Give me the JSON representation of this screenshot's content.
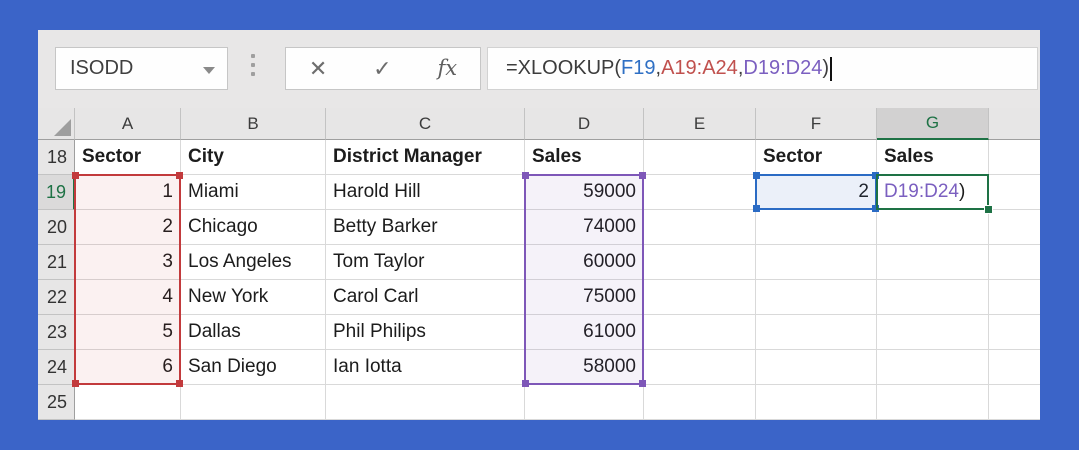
{
  "name_box": {
    "value": "ISODD"
  },
  "formula_buttons": {
    "cancel": "✕",
    "enter": "✓",
    "insert_function": "fx"
  },
  "formula_bar": {
    "tokens": [
      {
        "text": "=XLOOKUP(",
        "color": "#3c3c3c"
      },
      {
        "text": "F19",
        "color": "#2e6fc4"
      },
      {
        "text": ",",
        "color": "#3c3c3c"
      },
      {
        "text": "A19:A24",
        "color": "#c0504d"
      },
      {
        "text": ",",
        "color": "#3c3c3c"
      },
      {
        "text": "D19:D24",
        "color": "#7b5fc0"
      },
      {
        "text": ")",
        "color": "#3c3c3c"
      }
    ]
  },
  "sheet": {
    "columns": [
      "A",
      "B",
      "C",
      "D",
      "E",
      "F",
      "G"
    ],
    "active_column": "G",
    "active_row": "19",
    "rows": [
      {
        "num": "18",
        "cells": [
          {
            "col": "A",
            "text": "Sector",
            "bold": true
          },
          {
            "col": "B",
            "text": "City",
            "bold": true
          },
          {
            "col": "C",
            "text": "District Manager",
            "bold": true
          },
          {
            "col": "D",
            "text": "Sales",
            "bold": true
          },
          {
            "col": "F",
            "text": "Sector",
            "bold": true
          },
          {
            "col": "G",
            "text": "Sales",
            "bold": true
          }
        ]
      },
      {
        "num": "19",
        "cells": [
          {
            "col": "A",
            "text": "1",
            "align": "right"
          },
          {
            "col": "B",
            "text": "Miami"
          },
          {
            "col": "C",
            "text": "Harold Hill"
          },
          {
            "col": "D",
            "text": "59000",
            "align": "right"
          },
          {
            "col": "F",
            "text": "2",
            "align": "right"
          },
          {
            "col": "G",
            "tokens": [
              {
                "text": "D19:D24",
                "color": "#7b5fc0"
              },
              {
                "text": ")",
                "color": "#1c1c1c"
              }
            ]
          }
        ]
      },
      {
        "num": "20",
        "cells": [
          {
            "col": "A",
            "text": "2",
            "align": "right"
          },
          {
            "col": "B",
            "text": "Chicago"
          },
          {
            "col": "C",
            "text": "Betty Barker"
          },
          {
            "col": "D",
            "text": "74000",
            "align": "right"
          }
        ]
      },
      {
        "num": "21",
        "cells": [
          {
            "col": "A",
            "text": "3",
            "align": "right"
          },
          {
            "col": "B",
            "text": "Los Angeles"
          },
          {
            "col": "C",
            "text": "Tom Taylor"
          },
          {
            "col": "D",
            "text": "60000",
            "align": "right"
          }
        ]
      },
      {
        "num": "22",
        "cells": [
          {
            "col": "A",
            "text": "4",
            "align": "right"
          },
          {
            "col": "B",
            "text": "New York"
          },
          {
            "col": "C",
            "text": "Carol Carl"
          },
          {
            "col": "D",
            "text": "75000",
            "align": "right"
          }
        ]
      },
      {
        "num": "23",
        "cells": [
          {
            "col": "A",
            "text": "5",
            "align": "right"
          },
          {
            "col": "B",
            "text": "Dallas"
          },
          {
            "col": "C",
            "text": "Phil Philips"
          },
          {
            "col": "D",
            "text": "61000",
            "align": "right"
          }
        ]
      },
      {
        "num": "24",
        "cells": [
          {
            "col": "A",
            "text": "6",
            "align": "right"
          },
          {
            "col": "B",
            "text": "San Diego"
          },
          {
            "col": "C",
            "text": "Ian Iotta"
          },
          {
            "col": "D",
            "text": "58000",
            "align": "right"
          }
        ]
      },
      {
        "num": "25",
        "cells": []
      }
    ]
  },
  "selections": [
    {
      "name": "lookup-value-selection",
      "ref": "F19:F19",
      "border_color": "#2b6bc4",
      "fill": "rgba(60,110,200,0.10)",
      "handles": "corners"
    },
    {
      "name": "lookup-array-selection",
      "ref": "A19:A24",
      "border_color": "#c23a3c",
      "fill": "rgba(194,58,60,0.07)",
      "handles": "corners"
    },
    {
      "name": "return-array-selection",
      "ref": "D19:D24",
      "border_color": "#7e57b8",
      "fill": "rgba(126,87,184,0.08)",
      "handles": "corners"
    },
    {
      "name": "active-cell-selection",
      "ref": "G19:G19",
      "border_color": "#1e7245",
      "fill": "transparent",
      "handles": "fill-handle"
    }
  ],
  "colors": {
    "frame": "#3b64c8",
    "active_accent": "#1e7245"
  }
}
